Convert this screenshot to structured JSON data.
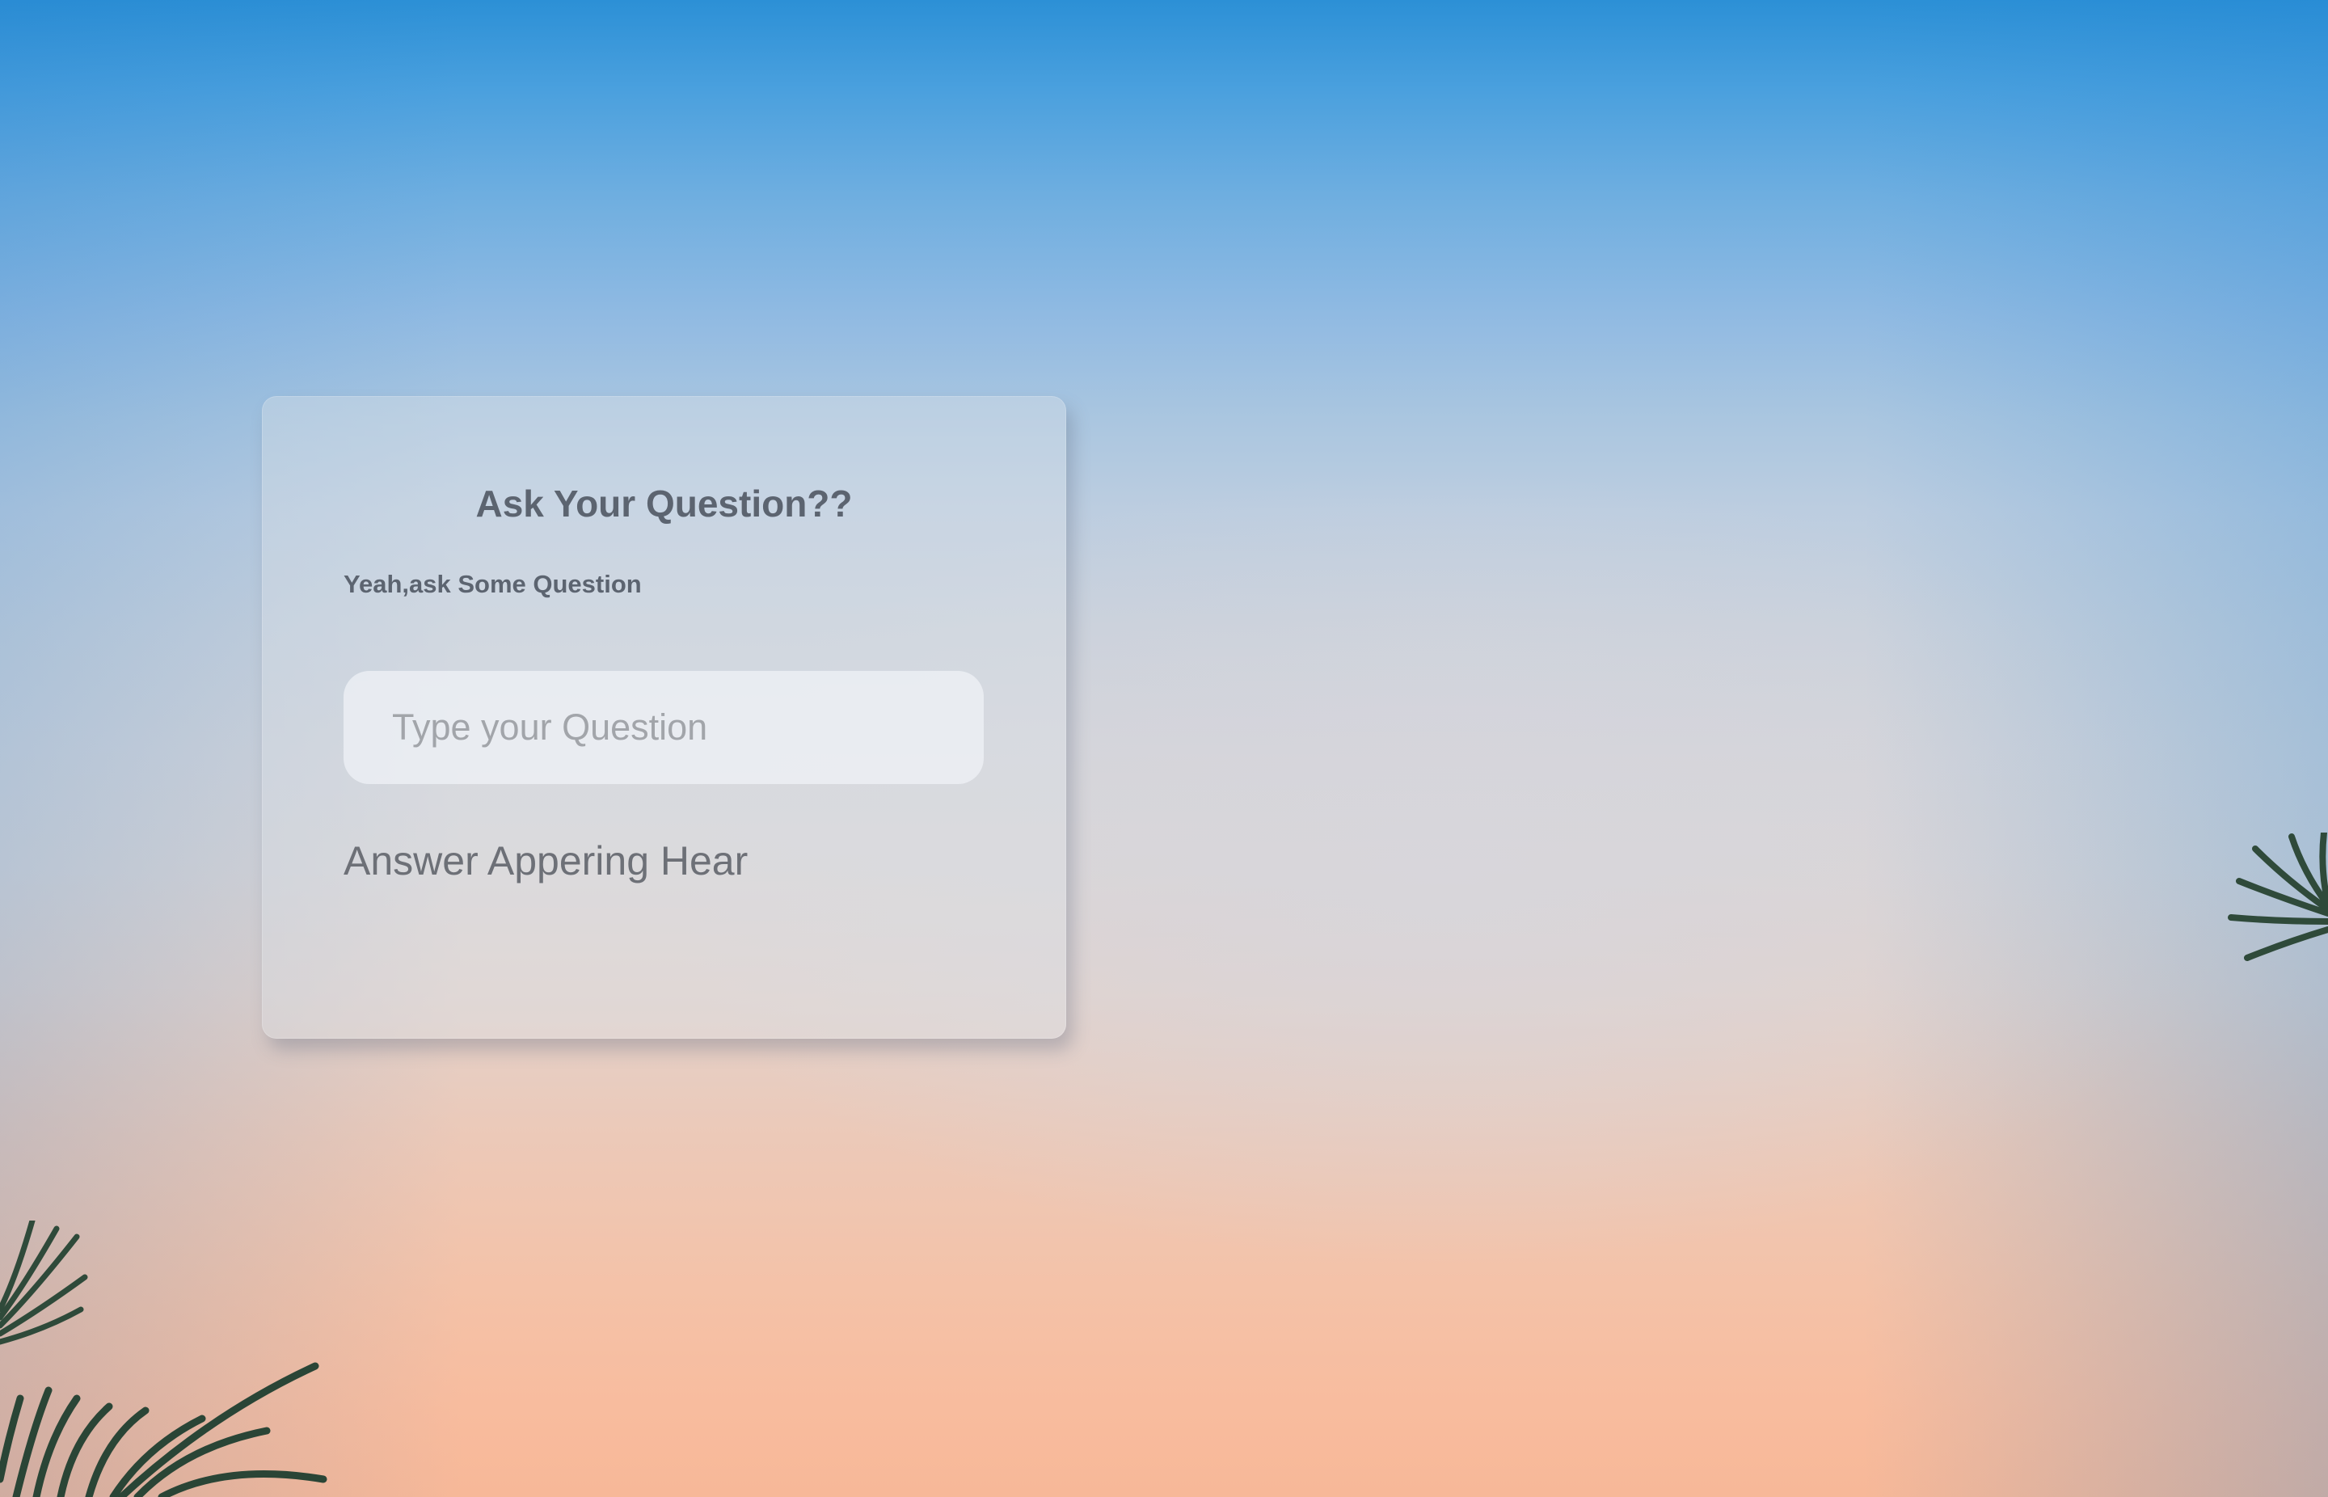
{
  "card": {
    "title": "Ask Your Question??",
    "subtitle": "Yeah,ask Some Question",
    "input_placeholder": "Type your Question",
    "input_value": "",
    "answer_text": "Answer Appering Hear"
  },
  "background": {
    "description_colors": {
      "sky_top": "#2c90d6",
      "sky_mid": "#d3d4da",
      "sky_bottom": "#f7b898"
    },
    "decorations": [
      "palm-leaves-bottom-left",
      "palm-leaves-right"
    ]
  }
}
